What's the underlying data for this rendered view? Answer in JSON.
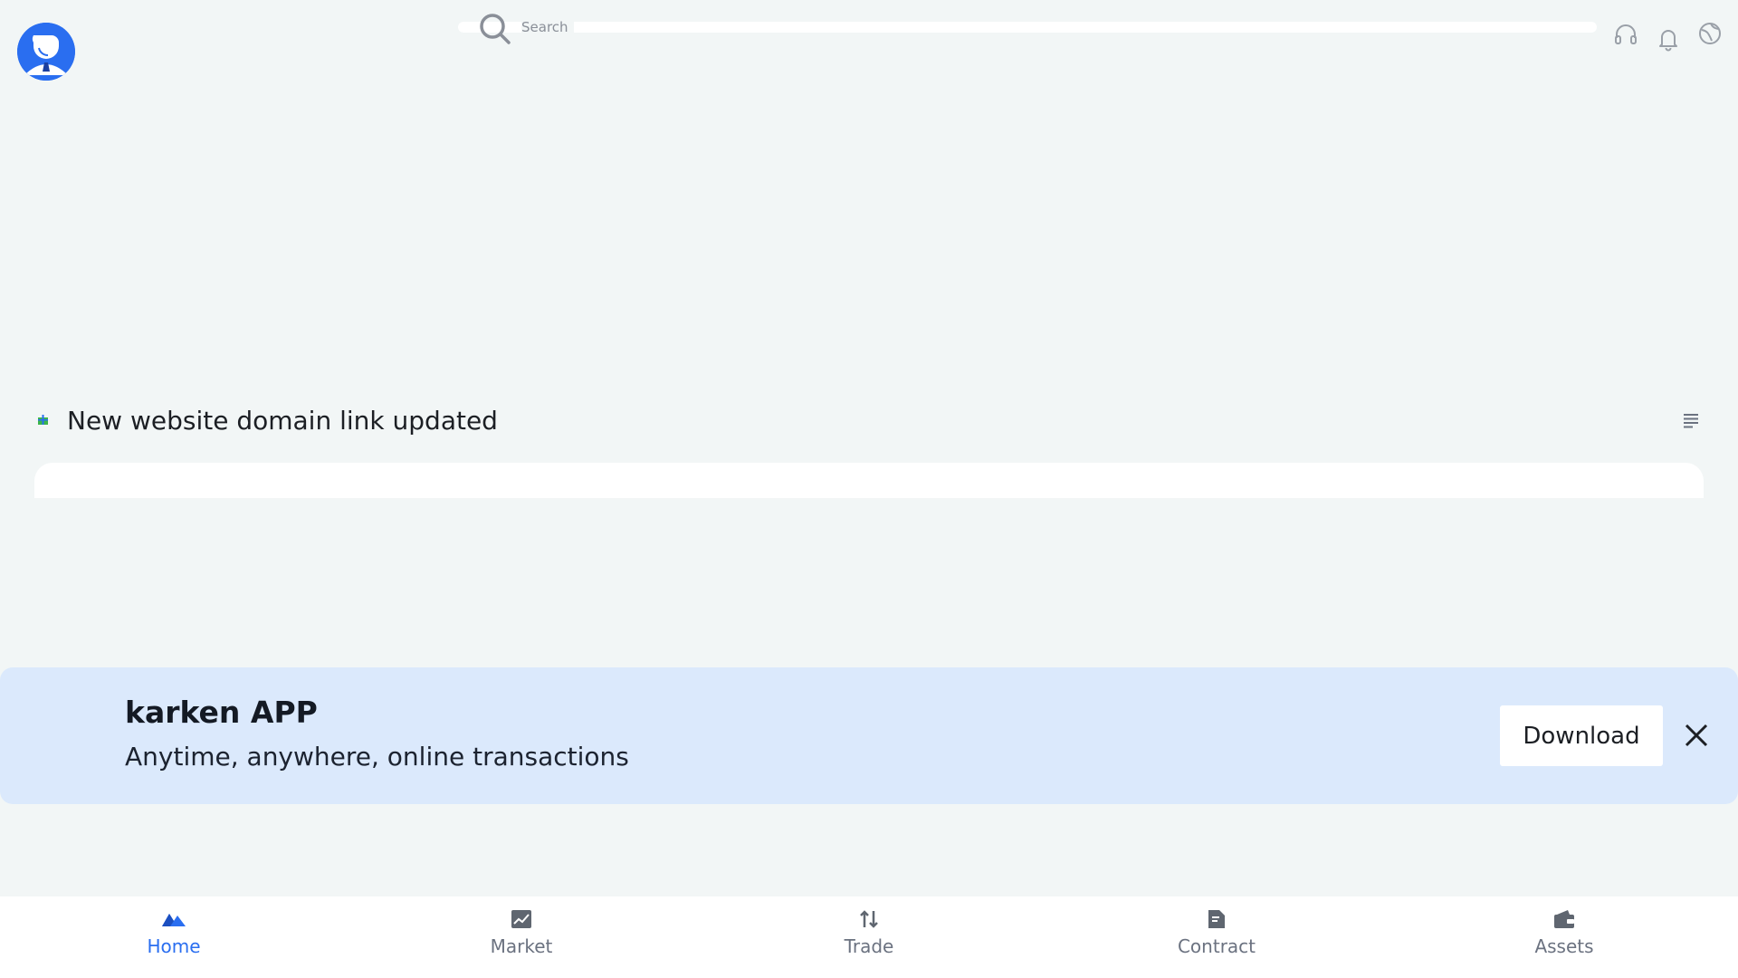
{
  "header": {
    "search_placeholder": "Search",
    "icons": [
      "headset-icon",
      "bell-icon",
      "globe-icon"
    ]
  },
  "notice": {
    "text": "New website domain link updated"
  },
  "app_banner": {
    "title": "karken APP",
    "subtitle": "Anytime, anywhere, online transactions",
    "download_label": "Download"
  },
  "bottom_nav": {
    "items": [
      {
        "label": "Home",
        "icon": "home-icon",
        "active": true
      },
      {
        "label": "Market",
        "icon": "market-icon",
        "active": false
      },
      {
        "label": "Trade",
        "icon": "trade-icon",
        "active": false
      },
      {
        "label": "Contract",
        "icon": "contract-icon",
        "active": false
      },
      {
        "label": "Assets",
        "icon": "wallet-icon",
        "active": false
      }
    ]
  },
  "colors": {
    "accent": "#2a6ef0",
    "background": "#f2f6f6",
    "banner": "#dbe9fc"
  }
}
